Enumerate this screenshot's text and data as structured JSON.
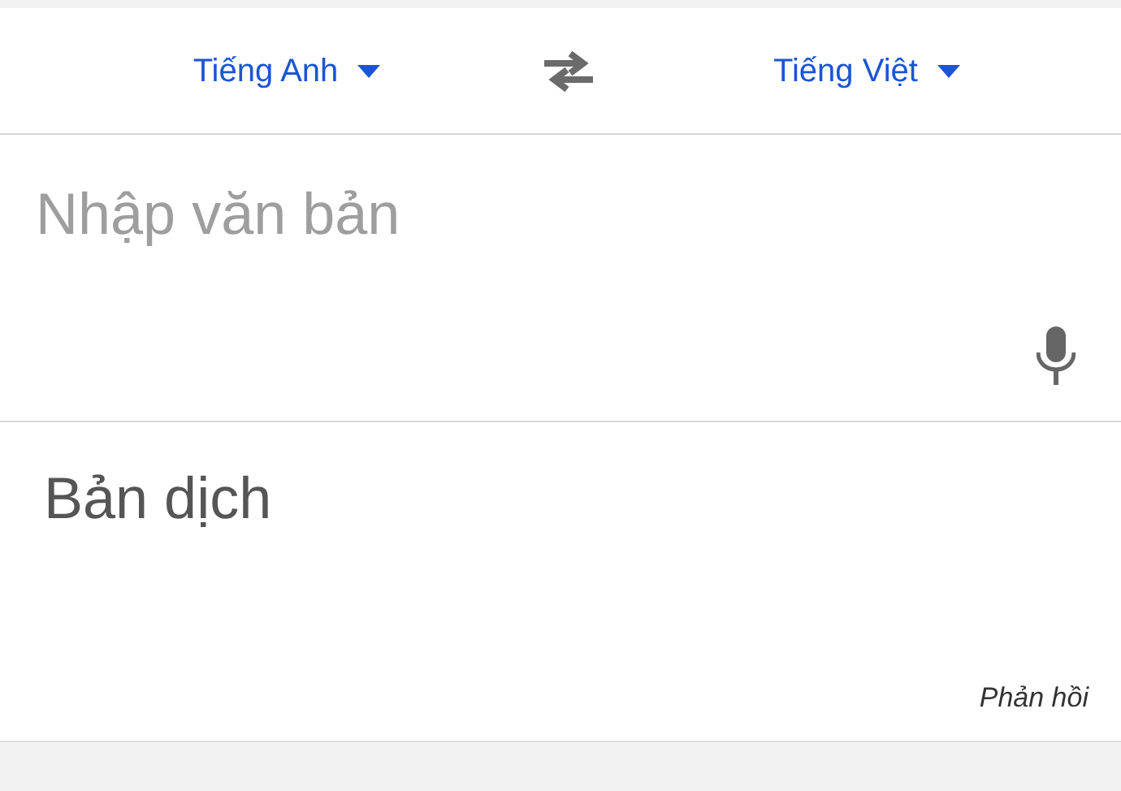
{
  "languages": {
    "source": "Tiếng Anh",
    "target": "Tiếng Việt"
  },
  "input": {
    "placeholder": "Nhập văn bản"
  },
  "output": {
    "text": "Bản dịch"
  },
  "feedback": "Phản hồi"
}
